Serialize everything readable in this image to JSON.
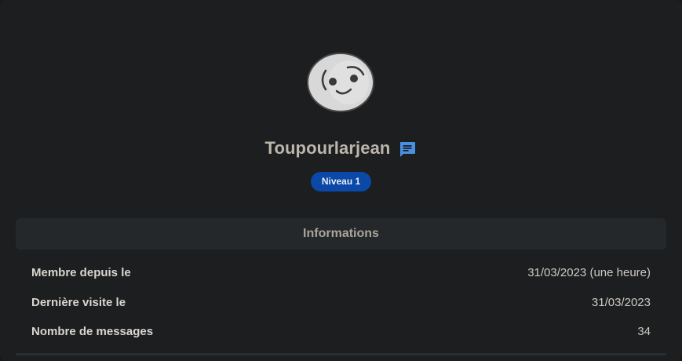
{
  "profile": {
    "username": "Toupourlarjean",
    "level_badge": "Niveau 1",
    "avatar_icon": "smiley-face-avatar",
    "message_icon": "chat-bubble-icon",
    "accent_color": "#4a90e2"
  },
  "informations": {
    "title": "Informations",
    "rows": [
      {
        "label": "Membre depuis le",
        "value": "31/03/2023 (une heure)"
      },
      {
        "label": "Dernière visite le",
        "value": "31/03/2023"
      },
      {
        "label": "Nombre de messages",
        "value": "34"
      }
    ]
  }
}
